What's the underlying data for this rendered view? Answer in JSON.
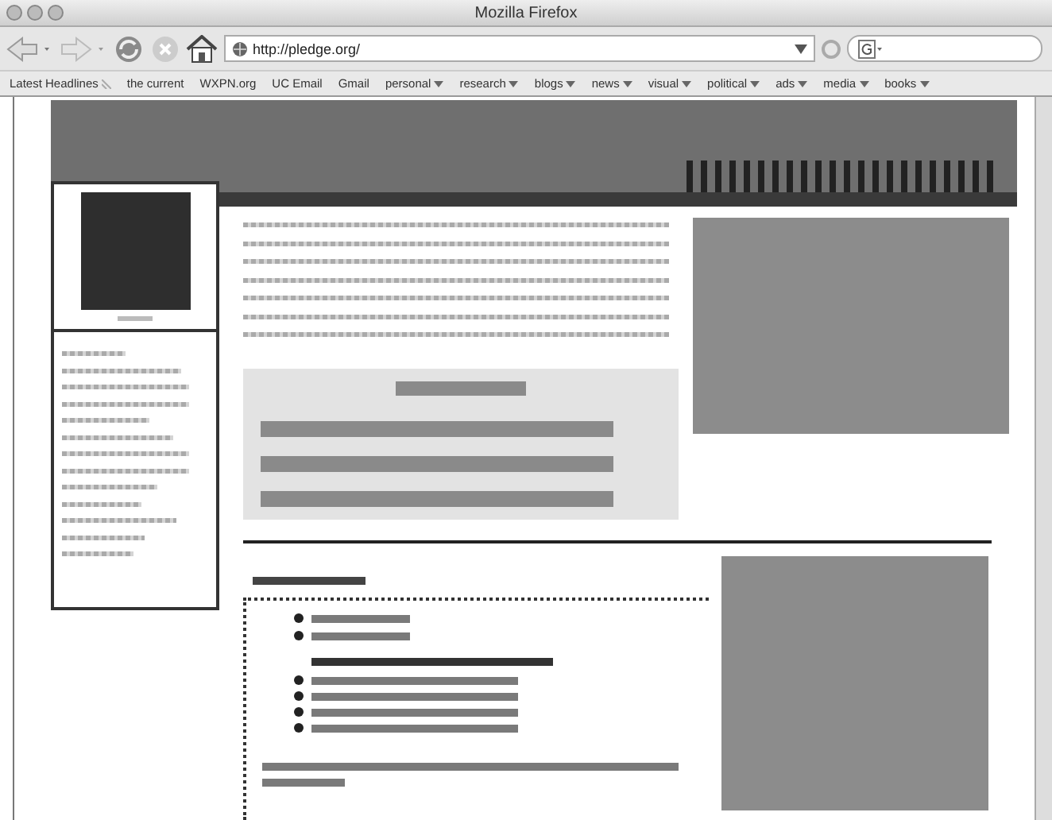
{
  "window": {
    "title": "Mozilla Firefox"
  },
  "toolbar": {
    "url": "http://pledge.org/"
  },
  "bookmarks": [
    {
      "label": "Latest Headlines",
      "kind": "feed"
    },
    {
      "label": "the current",
      "kind": "link"
    },
    {
      "label": "WXPN.org",
      "kind": "link"
    },
    {
      "label": "UC Email",
      "kind": "link"
    },
    {
      "label": "Gmail",
      "kind": "link"
    },
    {
      "label": "personal",
      "kind": "folder"
    },
    {
      "label": "research",
      "kind": "folder"
    },
    {
      "label": "blogs",
      "kind": "folder"
    },
    {
      "label": "news",
      "kind": "folder"
    },
    {
      "label": "visual",
      "kind": "folder"
    },
    {
      "label": "political",
      "kind": "folder"
    },
    {
      "label": "ads",
      "kind": "folder"
    },
    {
      "label": "media",
      "kind": "folder"
    },
    {
      "label": "books",
      "kind": "folder"
    }
  ]
}
